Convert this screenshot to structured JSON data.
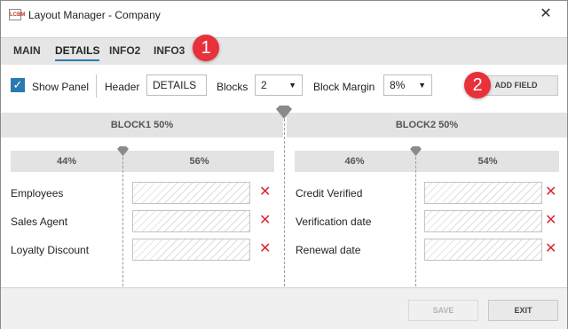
{
  "window": {
    "title": "Layout Manager - Company",
    "app_icon_text": "LCBM",
    "close_glyph": "✕"
  },
  "tabs": [
    {
      "label": "MAIN"
    },
    {
      "label": "DETAILS",
      "active": true
    },
    {
      "label": "INFO2"
    },
    {
      "label": "INFO3"
    }
  ],
  "badges": {
    "one": "1",
    "two": "2",
    "color": "#e8313a"
  },
  "toolbar": {
    "show_panel_label": "Show Panel",
    "show_panel_checked": true,
    "header_label": "Header",
    "header_value": "DETAILS",
    "blocks_label": "Blocks",
    "blocks_value": "2",
    "block_margin_label": "Block Margin",
    "block_margin_value": "8%",
    "add_field_label": "ADD FIELD"
  },
  "blocks": [
    {
      "title": "BLOCK1 50%",
      "split": [
        "44%",
        "56%"
      ],
      "fields": [
        "Employees",
        "Sales Agent",
        "Loyalty Discount"
      ]
    },
    {
      "title": "BLOCK2 50%",
      "split": [
        "46%",
        "54%"
      ],
      "fields": [
        "Credit Verified",
        "Verification date",
        "Renewal date"
      ]
    }
  ],
  "delete_glyph": "✕",
  "footer": {
    "save_label": "SAVE",
    "exit_label": "EXIT"
  },
  "colors": {
    "accent": "#2a7ab0",
    "delete": "#d9272e"
  }
}
